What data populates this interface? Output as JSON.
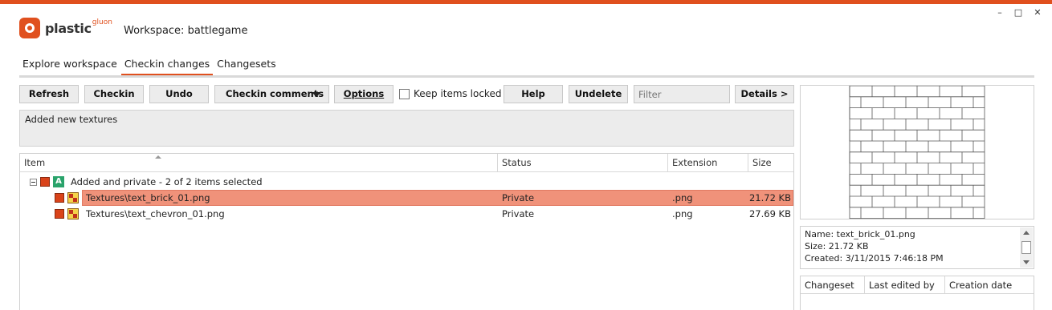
{
  "app": {
    "logo_text": "plastic",
    "logo_sup": "gluon",
    "workspace_title": "Workspace: battlegame",
    "window_controls": {
      "minimize": "–",
      "maximize": "□",
      "close": "✕"
    },
    "accent_color": "#e0501e"
  },
  "tabs": [
    {
      "label": "Explore workspace",
      "active": false
    },
    {
      "label": "Checkin changes",
      "active": true
    },
    {
      "label": "Changesets",
      "active": false
    }
  ],
  "toolbar": {
    "refresh": "Refresh",
    "checkin": "Checkin",
    "undo": "Undo",
    "checkin_comments": "Checkin comments",
    "options": "Options",
    "keep_items_locked": "Keep items locked",
    "keep_items_locked_checked": false,
    "help": "Help",
    "undelete": "Undelete",
    "filter_placeholder": "Filter",
    "details": "Details >"
  },
  "comment_text": "Added new textures",
  "grid": {
    "columns": [
      "Item",
      "Status",
      "Extension",
      "Size"
    ],
    "group": {
      "badge": "A",
      "label": "Added and private - 2 of 2 items selected"
    },
    "rows": [
      {
        "item": "Textures\\text_brick_01.png",
        "status": "Private",
        "extension": ".png",
        "size": "21.72 KB",
        "selected": true
      },
      {
        "item": "Textures\\text_chevron_01.png",
        "status": "Private",
        "extension": ".png",
        "size": "27.69 KB",
        "selected": false
      }
    ]
  },
  "details": {
    "name": "Name: text_brick_01.png",
    "size": "Size: 21.72 KB",
    "created": "Created: 3/11/2015 7:46:18 PM"
  },
  "history": {
    "columns": [
      "Changeset",
      "Last edited by",
      "Creation date"
    ]
  }
}
